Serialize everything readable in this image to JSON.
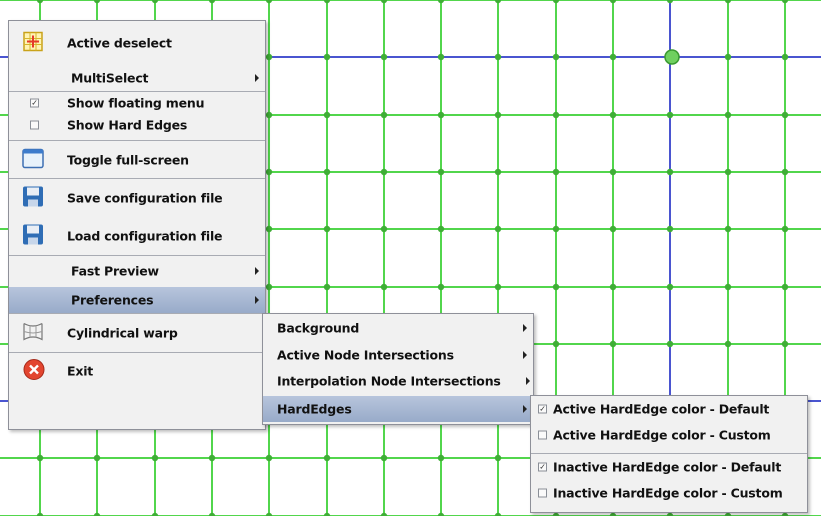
{
  "colors": {
    "grid_green": "#52d64c",
    "grid_blue": "#4a55d0",
    "node_green": "#3fae36",
    "menu_bg": "#f1f1f1",
    "highlight": "#a8b8d4"
  },
  "main_menu": {
    "items": [
      {
        "label": "Active deselect",
        "icon": "grid-select-icon"
      },
      {
        "label": "MultiSelect",
        "submenu": true
      },
      {
        "label": "Show floating menu",
        "checked": true
      },
      {
        "label": "Show Hard Edges",
        "checked": false
      },
      {
        "label": "Toggle full-screen",
        "icon": "window-icon"
      },
      {
        "label": "Save configuration file",
        "icon": "floppy-save-icon"
      },
      {
        "label": "Load configuration file",
        "icon": "floppy-load-icon"
      },
      {
        "label": "Fast Preview",
        "submenu": true
      },
      {
        "label": "Preferences",
        "submenu": true,
        "highlighted": true
      },
      {
        "label": "Cylindrical warp",
        "icon": "cylinder-warp-icon"
      },
      {
        "label": "Exit",
        "icon": "exit-icon"
      }
    ]
  },
  "preferences_menu": {
    "items": [
      {
        "label": "Background"
      },
      {
        "label": "Active Node Intersections"
      },
      {
        "label": "Interpolation Node Intersections"
      },
      {
        "label": "HardEdges",
        "highlighted": true
      }
    ]
  },
  "hardedges_menu": {
    "items": [
      {
        "label": "Active HardEdge color - Default",
        "checked": true
      },
      {
        "label": "Active HardEdge color - Custom",
        "checked": false
      },
      {
        "label": "Inactive HardEdge color - Default",
        "checked": true
      },
      {
        "label": "Inactive HardEdge color - Custom",
        "checked": false
      }
    ]
  }
}
